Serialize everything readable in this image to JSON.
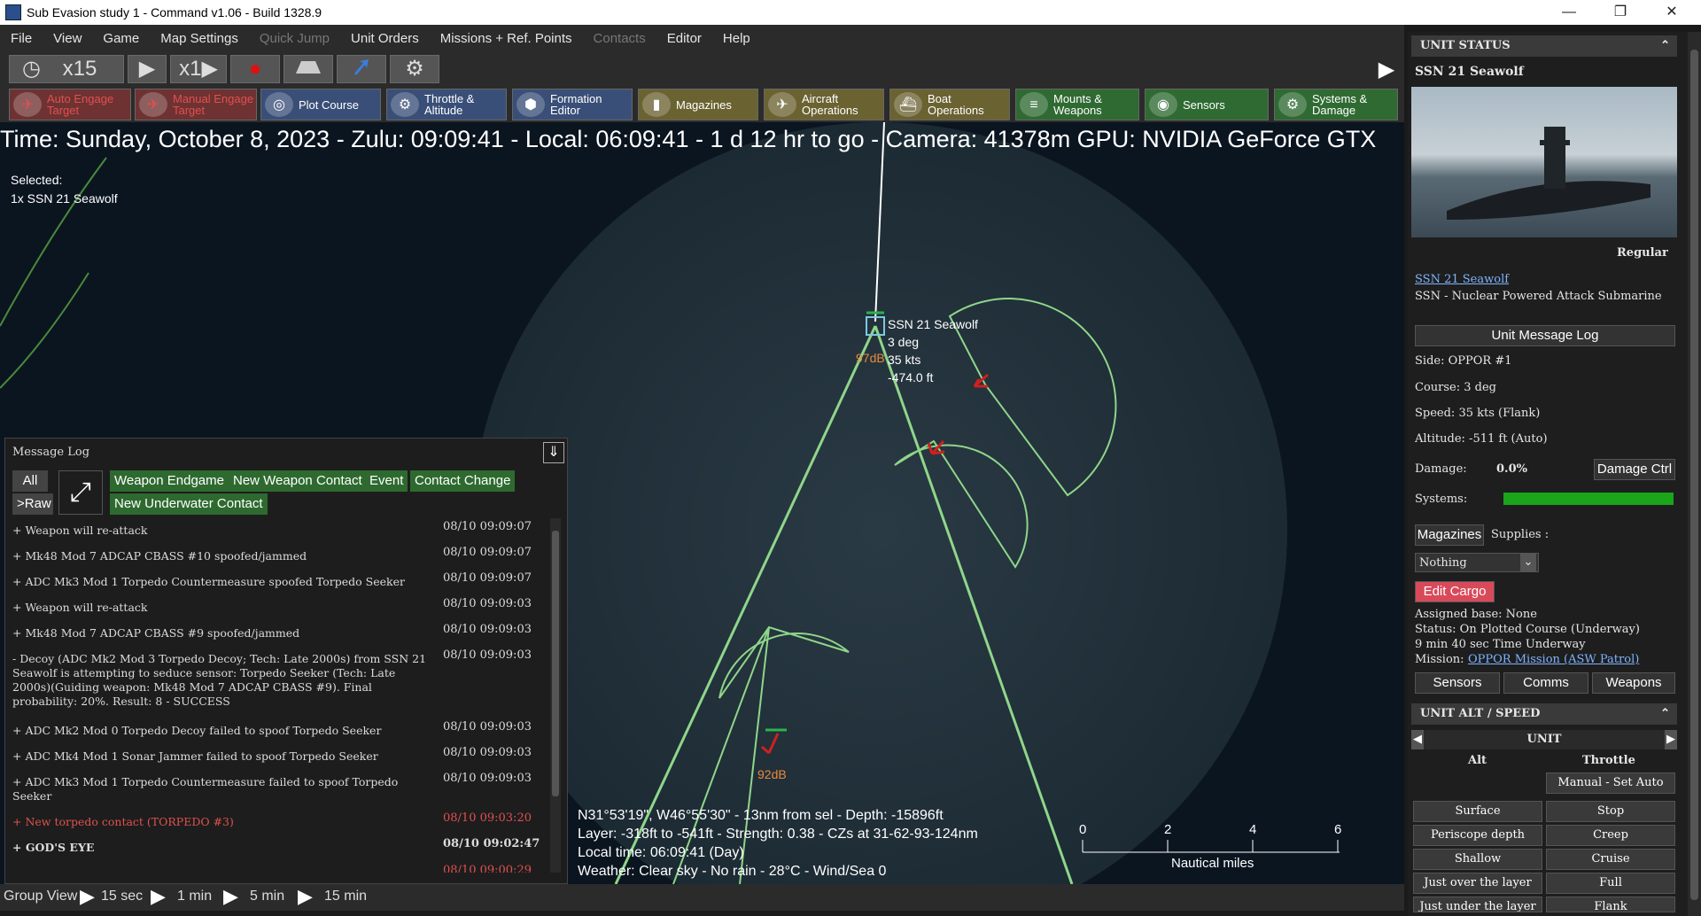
{
  "window": {
    "title": "Sub Evasion study 1 - Command v1.06 - Build 1328.9",
    "min": "—",
    "max": "❐",
    "close": "✕"
  },
  "menu": [
    "File",
    "View",
    "Game",
    "Map Settings",
    "Quick Jump",
    "Unit Orders",
    "Missions + Ref. Points",
    "Contacts",
    "Editor",
    "Help"
  ],
  "menu_disabled": [
    false,
    false,
    false,
    false,
    true,
    false,
    false,
    true,
    false,
    false
  ],
  "toolbar1": {
    "clock": "◷",
    "speed_x15": "x15",
    "play": "▶",
    "speed_x1": "x1▶",
    "record": "●",
    "gear": "⚙",
    "expand": "▶"
  },
  "toolbar2": [
    {
      "label": "Auto Engage Target",
      "style": "red",
      "icon": "✈"
    },
    {
      "label": "Manual Engage Target",
      "style": "red",
      "icon": "✈"
    },
    {
      "label": "Plot Course",
      "style": "blue",
      "icon": "◎"
    },
    {
      "label": "Throttle & Altitude",
      "style": "blue",
      "icon": "⚙"
    },
    {
      "label": "Formation Editor",
      "style": "blue",
      "icon": "⬢"
    },
    {
      "label": "Magazines",
      "style": "olive",
      "icon": "▮"
    },
    {
      "label": "Aircraft Operations",
      "style": "olive",
      "icon": "✈"
    },
    {
      "label": "Boat Operations",
      "style": "olive",
      "icon": "⛴"
    },
    {
      "label": "Mounts & Weapons",
      "style": "green",
      "icon": "≡"
    },
    {
      "label": "Sensors",
      "style": "green",
      "icon": "◉"
    },
    {
      "label": "Systems & Damage",
      "style": "green",
      "icon": "⚙"
    }
  ],
  "timebar": "Time: Sunday, October 8, 2023 - Zulu: 09:09:41 - Local: 06:09:41 - 1 d 12 hr to go -  Camera: 41378m  GPU: NVIDIA GeForce GTX",
  "selected": {
    "label": "Selected:",
    "value": "1x SSN 21 Seawolf"
  },
  "unit_label": {
    "name": "SSN 21 Seawolf",
    "course": "3 deg",
    "speed": "35 kts",
    "depth": "-474.0 ft",
    "db": "97dB"
  },
  "torpedo_db": "92dB",
  "message_log": {
    "title": "Message Log",
    "filters_row1": [
      "All",
      "Weapon Endgame",
      "New Weapon Contact",
      "Event",
      "Contact Change"
    ],
    "filters_row2": [
      ">Raw",
      "New Underwater Contact"
    ],
    "rows": [
      {
        "text": "+ Weapon will re-attack",
        "time": "08/10 09:09:07"
      },
      {
        "text": "+ Mk48 Mod 7 ADCAP CBASS #10 spoofed/jammed",
        "time": "08/10 09:09:07"
      },
      {
        "text": "+ ADC Mk3 Mod 1 Torpedo Countermeasure spoofed Torpedo Seeker",
        "time": "08/10 09:09:07"
      },
      {
        "text": "+ Weapon will re-attack",
        "time": "08/10 09:09:03"
      },
      {
        "text": "+ Mk48 Mod 7 ADCAP CBASS #9 spoofed/jammed",
        "time": "08/10 09:09:03"
      },
      {
        "text": "- Decoy (ADC Mk2 Mod 3 Torpedo Decoy; Tech: Late 2000s) from SSN 21 Seawolf is attempting to seduce sensor: Torpedo Seeker (Tech: Late 2000s)(Guiding weapon: Mk48 Mod 7 ADCAP CBASS #9). Final probability: 20%. Result: 8 - SUCCESS",
        "time": "08/10 09:09:03"
      },
      {
        "text": "+ ADC Mk2 Mod 0 Torpedo Decoy failed to spoof Torpedo Seeker",
        "time": "08/10 09:09:03"
      },
      {
        "text": "+ ADC Mk4 Mod 1 Sonar Jammer failed to spoof Torpedo Seeker",
        "time": "08/10 09:09:03"
      },
      {
        "text": "+ ADC Mk3 Mod 1 Torpedo Countermeasure failed to spoof Torpedo Seeker",
        "time": "08/10 09:09:03"
      },
      {
        "text": "+ New torpedo contact (TORPEDO #3)",
        "time": "08/10 09:03:20",
        "style": "red"
      },
      {
        "text": "+ GOD'S EYE",
        "time": "08/10 09:02:47",
        "style": "bold"
      }
    ],
    "partial_time": "08/10 09:00:29"
  },
  "coords": {
    "line1": "N31°53'19\", W46°55'30\" - 13nm from sel - Depth: -15896ft",
    "line2": "Layer: -318ft to -541ft - Strength: 0.38 - CZs at 31-62-93-124nm",
    "line3": "Local time: 06:09:41 (Day)",
    "line4": "Weather: Clear sky - No rain - 28°C - Wind/Sea 0"
  },
  "scale": {
    "ticks": [
      "0",
      "2",
      "4",
      "6"
    ],
    "label": "Nautical miles"
  },
  "statusbar": {
    "group_view": "Group View",
    "steps": [
      "15 sec",
      "1 min",
      "5 min",
      "15 min"
    ]
  },
  "panel": {
    "unit_status_header": "UNIT STATUS",
    "unit_name": "SSN 21 Seawolf",
    "proficiency": "Regular",
    "unit_link": "SSN 21 Seawolf",
    "unit_class": "SSN - Nuclear Powered Attack Submarine",
    "message_log_btn": "Unit Message Log",
    "side": "Side: OPPOR #1",
    "course": "Course: 3 deg",
    "speed": "Speed: 35 kts (Flank)",
    "altitude": "Altitude: -511 ft (Auto)",
    "damage_label": "Damage:",
    "damage_value": "0.0%",
    "damage_ctrl": "Damage Ctrl",
    "systems_label": "Systems:",
    "magazines_btn": "Magazines",
    "supplies_label": "Supplies :",
    "cargo_select": "Nothing",
    "edit_cargo": "Edit Cargo",
    "assigned_base": "Assigned base: None",
    "status": "Status: On Plotted Course (Underway)",
    "time_underway": "9 min 40 sec Time Underway",
    "mission_label": "Mission:",
    "mission_link": "OPPOR Mission (ASW Patrol)",
    "tabs": [
      "Sensors",
      "Comms",
      "Weapons"
    ],
    "alt_speed_header": "UNIT ALT / SPEED",
    "unit_nav": "UNIT",
    "alt_label": "Alt",
    "throttle_label": "Throttle",
    "manual_auto": "Manual - Set Auto",
    "alt_buttons": [
      "Surface",
      "Periscope depth",
      "Shallow",
      "Just over the layer",
      "Just under the layer"
    ],
    "throttle_buttons": [
      "Stop",
      "Creep",
      "Cruise",
      "Full",
      "Flank"
    ]
  },
  "colors": {
    "accent_green": "#2e6a2f",
    "range_line": "#8fd68a",
    "alert_red": "#e05050"
  }
}
